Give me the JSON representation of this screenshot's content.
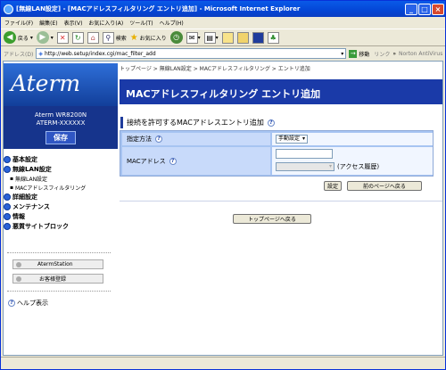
{
  "window": {
    "title": "[無線LAN設定] - [MACアドレスフィルタリング エントリ追加] - Microsoft Internet Explorer"
  },
  "menu": [
    "ファイル(F)",
    "編集(E)",
    "表示(V)",
    "お気に入り(A)",
    "ツール(T)",
    "ヘルプ(H)"
  ],
  "toolbar": {
    "back": "戻る",
    "search": "検索",
    "favorites": "お気に入り"
  },
  "addressbar": {
    "label": "アドレス(D)",
    "url": "http://web.setup/index.cgi/mac_filter_add",
    "go": "移動",
    "links": "リンク",
    "antivirus": "Norton AntiVirus"
  },
  "left": {
    "logo": "Aterm",
    "model": "Aterm WR8200N",
    "model2": "ATERM-XXXXXX",
    "save": "保存",
    "nav": {
      "basic": "基本設定",
      "wlan": "無線LAN設定",
      "wlan_sub1": "無線LAN設定",
      "wlan_sub2": "MACアドレスフィルタリング",
      "detail": "詳細設定",
      "maint": "メンテナンス",
      "info": "情報",
      "block": "悪質サイトブロック"
    },
    "btn_aterm": "AtermStation",
    "btn_register": "お客様登録",
    "help": "ヘルプ表示"
  },
  "main": {
    "breadcrumb": "トップページ > 無線LAN設定 > MACアドレスフィルタリング > エントリ追加",
    "header": "MACアドレスフィルタリング エントリ追加",
    "section_title": "接続を許可するMACアドレスエントリ追加",
    "method_label": "指定方法",
    "method_value": "手動設定",
    "mac_label": "MACアドレス",
    "mac_value": "",
    "access_history": "(アクセス履歴)",
    "set_button": "設定",
    "back_button": "前のページへ戻る",
    "top_button": "トップページへ戻る"
  }
}
